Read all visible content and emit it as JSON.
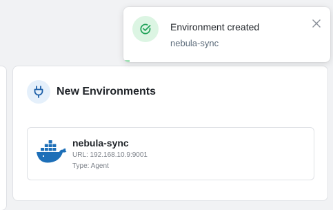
{
  "toast": {
    "title": "Environment created",
    "message": "nebula-sync",
    "icon": "check-circle-icon",
    "close_icon": "close-icon",
    "progress": 0.03,
    "accent_color": "#22a35a"
  },
  "card": {
    "title": "New Environments",
    "icon": "plug-icon",
    "environments": [
      {
        "name": "nebula-sync",
        "url": "URL: 192.168.10.9:9001",
        "type": "Type: Agent",
        "icon": "docker-icon"
      }
    ]
  },
  "colors": {
    "docker_blue": "#1d6fb8",
    "plug_badge_bg": "#e5f0fb",
    "success_bg": "#dcf5e3"
  }
}
